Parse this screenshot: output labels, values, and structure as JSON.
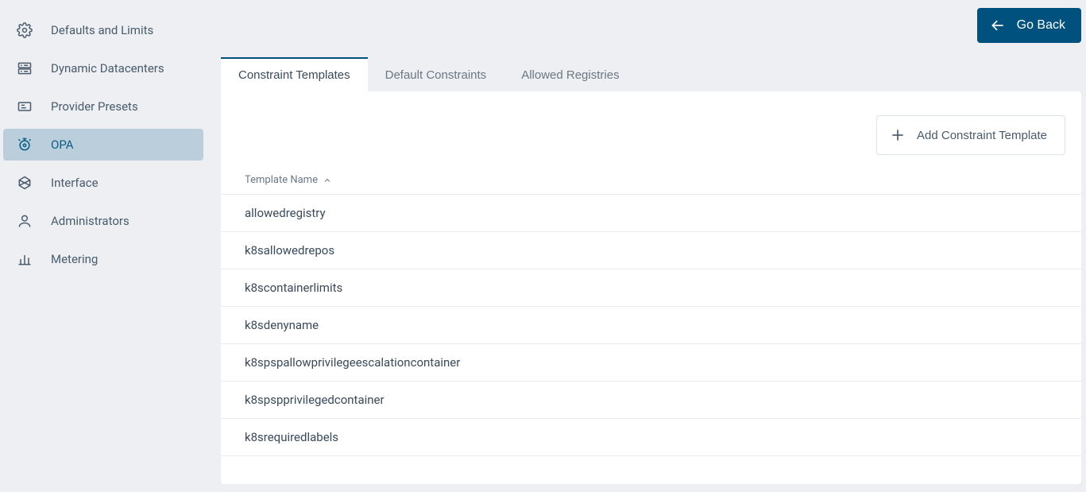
{
  "header": {
    "go_back": "Go Back"
  },
  "sidebar": {
    "items": [
      {
        "key": "defaults",
        "label": "Defaults and Limits"
      },
      {
        "key": "datacenters",
        "label": "Dynamic Datacenters"
      },
      {
        "key": "presets",
        "label": "Provider Presets"
      },
      {
        "key": "opa",
        "label": "OPA"
      },
      {
        "key": "interface",
        "label": "Interface"
      },
      {
        "key": "admins",
        "label": "Administrators"
      },
      {
        "key": "metering",
        "label": "Metering"
      }
    ],
    "active_index": 3
  },
  "tabs": {
    "items": [
      {
        "key": "templates",
        "label": "Constraint Templates"
      },
      {
        "key": "defaults",
        "label": "Default Constraints"
      },
      {
        "key": "registries",
        "label": "Allowed Registries"
      }
    ],
    "active_index": 0
  },
  "actions": {
    "add_template": "Add Constraint Template"
  },
  "table": {
    "column_header": "Template Name",
    "sort": "asc",
    "rows": [
      "allowedregistry",
      "k8sallowedrepos",
      "k8scontainerlimits",
      "k8sdenyname",
      "k8spspallowprivilegeescalationcontainer",
      "k8spspprivilegedcontainer",
      "k8srequiredlabels"
    ]
  }
}
